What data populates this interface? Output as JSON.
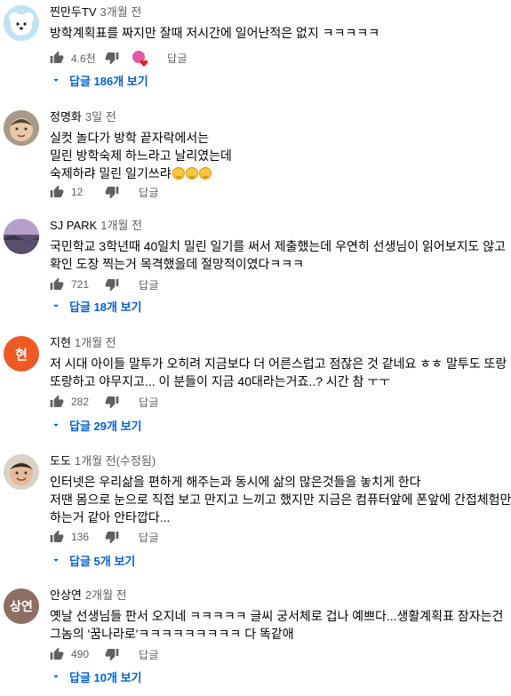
{
  "comments": [
    {
      "author": "찐만두TV",
      "time": "3개월 전",
      "lines": [
        "방학계획표를 짜지만 잘때 저시간에 일어난적은 없지 ㅋㅋㅋㅋㅋ"
      ],
      "likes": "4.6천",
      "reply_label": "답글",
      "replies_label": "답글 186개 보기",
      "creator_heart": true
    },
    {
      "author": "정명화",
      "time": "3일 전",
      "lines": [
        "실컷 놀다가 방학 끝자락에서는",
        "밀린 방학숙제 하느라고 날리였는데",
        "숙제하랴 밀린 일기쓰랴"
      ],
      "likes": "12",
      "reply_label": "답글"
    },
    {
      "author": "SJ PARK",
      "time": "1개월 전",
      "lines": [
        "국민학교 3학년때 40일치 밀린 일기를 써서 제출했는데 우연히 선생님이 읽어보지도 않고",
        "확인 도장 찍는거 목격했을데 절망적이였다ㅋㅋㅋ"
      ],
      "likes": "721",
      "reply_label": "답글",
      "replies_label": "답글 18개 보기"
    },
    {
      "author": "지현",
      "time": "1개월 전",
      "avatar_letter": "현",
      "lines": [
        "저 시대 아이들 말투가 오히려 지금보다 더 어른스럽고 점잖은 것 같네요 ㅎㅎ 말투도 또랑",
        "또랑하고 야무지고... 이 분들이 지금 40대라는거죠..? 시간 참 ㅜㅜ"
      ],
      "likes": "282",
      "reply_label": "답글",
      "replies_label": "답글 29개 보기"
    },
    {
      "author": "도도",
      "time": "1개월 전(수정됨)",
      "lines": [
        "인터넷은 우리삶을 편하게 해주는과 동시에 삶의 많은것들을 놓치게 한다",
        "저땐 몸으로 눈으로 직접 보고 만지고 느끼고 했지만 지금은 컴퓨터앞에 폰앞에 간접체험만",
        "하는거 같아 안타깝다..."
      ],
      "likes": "136",
      "reply_label": "답글",
      "replies_label": "답글 5개 보기"
    },
    {
      "author": "안상연",
      "time": "2개월 전",
      "avatar_letter": "상연",
      "lines": [
        "옛날 선생님들 판서 오지네 ㅋㅋㅋㅋㅋ 글씨 궁서체로 겁나 예쁘다...생활계획표 잠자는건",
        "그놈의 '꿈나라로'ㅋㅋㅋㅋㅋㅋㅋㅋㅋ 다 똑같애"
      ],
      "likes": "490",
      "reply_label": "답글",
      "replies_label": "답글 10개 보기"
    }
  ],
  "colors": {
    "link": "#065fd4",
    "meta": "#606060",
    "avatar_jihyun": "#ef5a24",
    "avatar_sangyeon": "#8d6e63"
  },
  "icons": [
    "thumb-up-icon",
    "thumb-down-icon",
    "creator-heart-icon",
    "chevron-down-icon",
    "emoji-icon"
  ]
}
